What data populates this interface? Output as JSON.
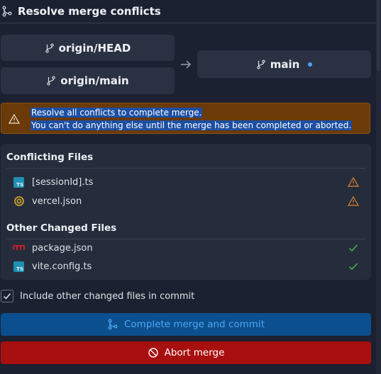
{
  "header": {
    "title": "Resolve merge conflicts",
    "icon": "git-merge-icon"
  },
  "branches": {
    "source": [
      "origin/HEAD",
      "origin/main"
    ],
    "target": "main",
    "target_indicator_color": "#4da3ff"
  },
  "warning": {
    "line1": "Resolve all conflicts to complete merge.",
    "line2": "You can't do anything else until the merge has been completed or aborted."
  },
  "conflicting": {
    "title": "Conflicting Files",
    "files": [
      {
        "name": "[sessionId].ts",
        "icon": "typescript-icon",
        "status": "warning"
      },
      {
        "name": "vercel.json",
        "icon": "json-icon",
        "status": "warning"
      }
    ]
  },
  "other": {
    "title": "Other Changed Files",
    "files": [
      {
        "name": "package.json",
        "icon": "npm-icon",
        "status": "resolved"
      },
      {
        "name": "vite.config.ts",
        "icon": "typescript-icon",
        "status": "resolved"
      }
    ]
  },
  "include_checkbox": {
    "label": "Include other changed files in commit",
    "checked": true
  },
  "buttons": {
    "complete": "Complete merge and commit",
    "abort": "Abort merge"
  },
  "colors": {
    "warning_bg": "#6a3a08",
    "complete_btn": "#0b4f8f",
    "abort_btn": "#a80f0f",
    "resolved_check": "#3fb950",
    "warning_triangle": "#e0822f"
  }
}
